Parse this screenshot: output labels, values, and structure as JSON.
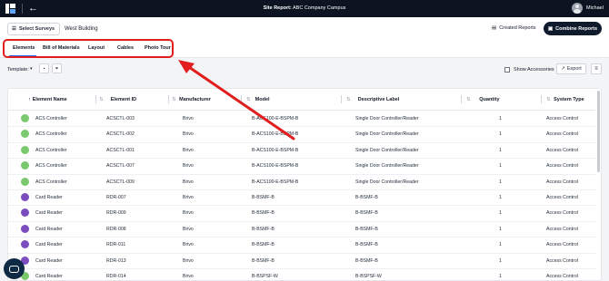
{
  "topbar": {
    "title_prefix": "Site Report:",
    "title_value": "ABC Company Campus",
    "user": "Michael"
  },
  "header": {
    "select_surveys": "Select Surveys",
    "building": "West Building",
    "created_reports": "Created Reports",
    "combine_reports": "Combine Reports"
  },
  "tabs": [
    "Elements",
    "Bill of Materials",
    "Layout",
    "Cables",
    "Photo Tour"
  ],
  "toolbar": {
    "template_label": "Template:",
    "show_accessories": "Show Accessories",
    "export": "Export"
  },
  "table": {
    "columns": [
      "Element Name",
      "Element ID",
      "Manufacturer",
      "Model",
      "Descriptive Label",
      "Quantity",
      "System Type"
    ],
    "rows": [
      {
        "name": "ACS Controller",
        "id": "ACSCTL-003",
        "mfr": "Brivo",
        "model": "B-ACS100-E-BSPM-B",
        "label": "Single Door Controller/Reader",
        "qty": "1",
        "type": "Access Control",
        "icon": "green"
      },
      {
        "name": "ACS Controller",
        "id": "ACSCTL-002",
        "mfr": "Brivo",
        "model": "B-ACS100-E-BSPM-B",
        "label": "Single Door Controller/Reader",
        "qty": "1",
        "type": "Access Control",
        "icon": "green"
      },
      {
        "name": "ACS Controller",
        "id": "ACSCTL-001",
        "mfr": "Brivo",
        "model": "B-ACS100-E-BSPM-B",
        "label": "Single Door Controller/Reader",
        "qty": "1",
        "type": "Access Control",
        "icon": "green"
      },
      {
        "name": "ACS Controller",
        "id": "ACSCTL-007",
        "mfr": "Brivo",
        "model": "B-ACS100-E-BSPM-B",
        "label": "Single Door Controller/Reader",
        "qty": "1",
        "type": "Access Control",
        "icon": "green"
      },
      {
        "name": "ACS Controller",
        "id": "ACSCTL-009",
        "mfr": "Brivo",
        "model": "B-ACS100-E-BSPM-B",
        "label": "Single Door Controller/Reader",
        "qty": "1",
        "type": "Access Control",
        "icon": "green"
      },
      {
        "name": "Card Reader",
        "id": "RDR-007",
        "mfr": "Brivo",
        "model": "B-BSMF-B",
        "label": "B-BSMF-B",
        "qty": "1",
        "type": "Access Control",
        "icon": "purple"
      },
      {
        "name": "Card Reader",
        "id": "RDR-009",
        "mfr": "Brivo",
        "model": "B-BSMF-B",
        "label": "B-BSMF-B",
        "qty": "1",
        "type": "Access Control",
        "icon": "purple"
      },
      {
        "name": "Card Reader",
        "id": "RDR-008",
        "mfr": "Brivo",
        "model": "B-BSMF-B",
        "label": "B-BSMF-B",
        "qty": "1",
        "type": "Access Control",
        "icon": "purple"
      },
      {
        "name": "Card Reader",
        "id": "RDR-011",
        "mfr": "Brivo",
        "model": "B-BSMF-B",
        "label": "B-BSMF-B",
        "qty": "1",
        "type": "Access Control",
        "icon": "purple"
      },
      {
        "name": "Card Reader",
        "id": "RDR-013",
        "mfr": "Brivo",
        "model": "B-BSMF-B",
        "label": "B-BSMF-B",
        "qty": "1",
        "type": "Access Control",
        "icon": "purple"
      },
      {
        "name": "Card Reader",
        "id": "RDR-014",
        "mfr": "Brivo",
        "model": "B-BSPSF-W",
        "label": "B-BSPSF-W",
        "qty": "1",
        "type": "Access Control",
        "icon": "green"
      }
    ]
  },
  "colors": {
    "topbar": "#0b1420",
    "highlight": "#e11d1d",
    "combine_button": "#0f1b2d",
    "icon_green": "#7bc96f",
    "icon_purple": "#7c4dbf"
  }
}
